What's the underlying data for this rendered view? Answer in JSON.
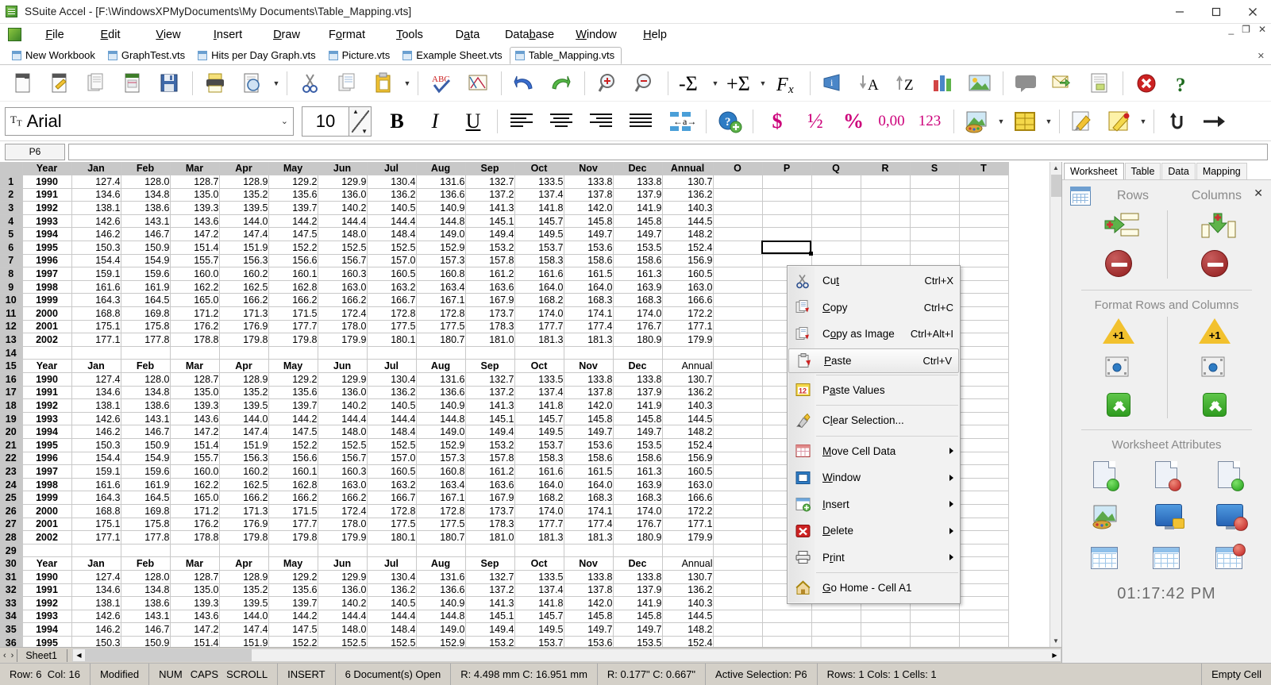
{
  "window": {
    "title": "SSuite Accel - [F:\\WindowsXPMyDocuments\\My Documents\\Table_Mapping.vts]",
    "minimize": "–",
    "maximize": "☐",
    "close": "✕",
    "inner_minimize": "_",
    "inner_restore": "❐",
    "inner_close": "✕"
  },
  "menubar": [
    {
      "label": "File",
      "accel": "F"
    },
    {
      "label": "Edit",
      "accel": "E"
    },
    {
      "label": "View",
      "accel": "V"
    },
    {
      "label": "Insert",
      "accel": "I"
    },
    {
      "label": "Draw",
      "accel": "D"
    },
    {
      "label": "Format",
      "accel": "o"
    },
    {
      "label": "Tools",
      "accel": "T"
    },
    {
      "label": "Data",
      "accel": "a"
    },
    {
      "label": "Database",
      "accel": "b"
    },
    {
      "label": "Window",
      "accel": "W"
    },
    {
      "label": "Help",
      "accel": "H"
    }
  ],
  "doctabs": [
    {
      "label": "New Workbook",
      "active": false
    },
    {
      "label": "GraphTest.vts",
      "active": false
    },
    {
      "label": "Hits per Day Graph.vts",
      "active": false
    },
    {
      "label": "Picture.vts",
      "active": false
    },
    {
      "label": "Example Sheet.vts",
      "active": false
    },
    {
      "label": "Table_Mapping.vts",
      "active": true
    }
  ],
  "toolbar_icons": [
    "new-document-icon",
    "open-document-icon",
    "copy-document-icon",
    "document-properties-icon",
    "save-icon",
    "print-icon",
    "print-preview-icon",
    "cut-icon",
    "copy-icon",
    "paste-icon",
    "spellcheck-icon",
    "drawing-icon",
    "chart-icon",
    "undo-icon",
    "redo-icon",
    "zoom-in-icon",
    "zoom-out-icon",
    "sum-minus-icon",
    "sum-plus-icon",
    "function-icon",
    "info-icon",
    "sort-ascending-icon",
    "sort-descending-icon",
    "bar-chart-icon",
    "image-icon",
    "comment-icon",
    "send-mail-icon",
    "report-icon",
    "close-document-icon",
    "help-icon"
  ],
  "format_toolbar": {
    "font_name": "Arial",
    "font_size": "10",
    "bold": "B",
    "italic": "I",
    "underline": "U",
    "align_left": "align-left-icon",
    "align_center": "align-center-icon",
    "align_right": "align-right-icon",
    "align_justify": "align-justify-icon",
    "merge": "←a→",
    "help_add": "help-add-icon",
    "currency": "$",
    "fraction": "½",
    "percent": "%",
    "decimal": "0,00",
    "number": "123",
    "fill_color": "fill-color-icon",
    "borders": "borders-icon",
    "brush": "format-painter-icon",
    "pencil": "edit-pencil-icon",
    "refresh": "refresh-icon",
    "arrow": "go-arrow-icon"
  },
  "formula_bar": {
    "name_box": "P6",
    "formula": ""
  },
  "grid": {
    "column_letters": [
      "",
      "Year",
      "Jan",
      "Feb",
      "Mar",
      "Apr",
      "May",
      "Jun",
      "Jul",
      "Aug",
      "Sep",
      "Oct",
      "Nov",
      "Dec",
      "Annual",
      "O",
      "P",
      "Q",
      "R",
      "S",
      "T"
    ],
    "extra_columns": [
      "O",
      "P",
      "Q",
      "R",
      "S",
      "T"
    ],
    "selected_cell": "P6",
    "headers": [
      "Year",
      "Jan",
      "Feb",
      "Mar",
      "Apr",
      "May",
      "Jun",
      "Jul",
      "Aug",
      "Sep",
      "Oct",
      "Nov",
      "Dec",
      "Annual"
    ],
    "rows_data": [
      {
        "year": "1990",
        "m": [
          "127.4",
          "128.0",
          "128.7",
          "128.9",
          "129.2",
          "129.9",
          "130.4",
          "131.6",
          "132.7",
          "133.5",
          "133.8",
          "133.8"
        ],
        "annual": "130.7"
      },
      {
        "year": "1991",
        "m": [
          "134.6",
          "134.8",
          "135.0",
          "135.2",
          "135.6",
          "136.0",
          "136.2",
          "136.6",
          "137.2",
          "137.4",
          "137.8",
          "137.9"
        ],
        "annual": "136.2"
      },
      {
        "year": "1992",
        "m": [
          "138.1",
          "138.6",
          "139.3",
          "139.5",
          "139.7",
          "140.2",
          "140.5",
          "140.9",
          "141.3",
          "141.8",
          "142.0",
          "141.9"
        ],
        "annual": "140.3"
      },
      {
        "year": "1993",
        "m": [
          "142.6",
          "143.1",
          "143.6",
          "144.0",
          "144.2",
          "144.4",
          "144.4",
          "144.8",
          "145.1",
          "145.7",
          "145.8",
          "145.8"
        ],
        "annual": "144.5"
      },
      {
        "year": "1994",
        "m": [
          "146.2",
          "146.7",
          "147.2",
          "147.4",
          "147.5",
          "148.0",
          "148.4",
          "149.0",
          "149.4",
          "149.5",
          "149.7",
          "149.7"
        ],
        "annual": "148.2"
      },
      {
        "year": "1995",
        "m": [
          "150.3",
          "150.9",
          "151.4",
          "151.9",
          "152.2",
          "152.5",
          "152.5",
          "152.9",
          "153.2",
          "153.7",
          "153.6",
          "153.5"
        ],
        "annual": "152.4"
      },
      {
        "year": "1996",
        "m": [
          "154.4",
          "154.9",
          "155.7",
          "156.3",
          "156.6",
          "156.7",
          "157.0",
          "157.3",
          "157.8",
          "158.3",
          "158.6",
          "158.6"
        ],
        "annual": "156.9"
      },
      {
        "year": "1997",
        "m": [
          "159.1",
          "159.6",
          "160.0",
          "160.2",
          "160.1",
          "160.3",
          "160.5",
          "160.8",
          "161.2",
          "161.6",
          "161.5",
          "161.3"
        ],
        "annual": "160.5"
      },
      {
        "year": "1998",
        "m": [
          "161.6",
          "161.9",
          "162.2",
          "162.5",
          "162.8",
          "163.0",
          "163.2",
          "163.4",
          "163.6",
          "164.0",
          "164.0",
          "163.9"
        ],
        "annual": "163.0"
      },
      {
        "year": "1999",
        "m": [
          "164.3",
          "164.5",
          "165.0",
          "166.2",
          "166.2",
          "166.2",
          "166.7",
          "167.1",
          "167.9",
          "168.2",
          "168.3",
          "168.3"
        ],
        "annual": "166.6"
      },
      {
        "year": "2000",
        "m": [
          "168.8",
          "169.8",
          "171.2",
          "171.3",
          "171.5",
          "172.4",
          "172.8",
          "172.8",
          "173.7",
          "174.0",
          "174.1",
          "174.0"
        ],
        "annual": "172.2"
      },
      {
        "year": "2001",
        "m": [
          "175.1",
          "175.8",
          "176.2",
          "176.9",
          "177.7",
          "178.0",
          "177.5",
          "177.5",
          "178.3",
          "177.7",
          "177.4",
          "176.7"
        ],
        "annual": "177.1"
      },
      {
        "year": "2002",
        "m": [
          "177.1",
          "177.8",
          "178.8",
          "179.8",
          "179.8",
          "179.9",
          "180.1",
          "180.7",
          "181.0",
          "181.3",
          "181.3",
          "180.9"
        ],
        "annual": "179.9"
      }
    ]
  },
  "context_menu": {
    "items": [
      {
        "label": "Cut",
        "accel": "t",
        "shortcut": "Ctrl+X",
        "icon": "cut-icon",
        "submenu": false,
        "selected": false
      },
      {
        "label": "Copy",
        "accel": "C",
        "shortcut": "Ctrl+C",
        "icon": "copy-icon",
        "submenu": false,
        "selected": false
      },
      {
        "label": "Copy as Image",
        "accel": "o",
        "shortcut": "Ctrl+Alt+I",
        "icon": "copy-image-icon",
        "submenu": false,
        "selected": false
      },
      {
        "label": "Paste",
        "accel": "P",
        "shortcut": "Ctrl+V",
        "icon": "paste-icon",
        "submenu": false,
        "selected": true
      },
      {
        "label": "Paste Values",
        "accel": "a",
        "shortcut": "",
        "icon": "paste-values-icon",
        "submenu": false,
        "selected": false
      },
      {
        "label": "Clear Selection...",
        "accel": "l",
        "shortcut": "",
        "icon": "clear-selection-icon",
        "submenu": false,
        "selected": false
      },
      {
        "label": "Move Cell Data",
        "accel": "M",
        "shortcut": "",
        "icon": "move-cell-icon",
        "submenu": true,
        "selected": false
      },
      {
        "label": "Window",
        "accel": "W",
        "shortcut": "",
        "icon": "window-icon",
        "submenu": true,
        "selected": false
      },
      {
        "label": "Insert",
        "accel": "I",
        "shortcut": "",
        "icon": "insert-icon",
        "submenu": true,
        "selected": false
      },
      {
        "label": "Delete",
        "accel": "D",
        "shortcut": "",
        "icon": "delete-icon",
        "submenu": true,
        "selected": false
      },
      {
        "label": "Print",
        "accel": "r",
        "shortcut": "",
        "icon": "print-icon",
        "submenu": true,
        "selected": false
      },
      {
        "label": "Go Home - Cell A1",
        "accel": "G",
        "shortcut": "",
        "icon": "home-icon",
        "submenu": false,
        "selected": false
      }
    ]
  },
  "right_panel": {
    "tabs": [
      {
        "label": "Worksheet",
        "active": true
      },
      {
        "label": "Table",
        "active": false
      },
      {
        "label": "Data",
        "active": false
      },
      {
        "label": "Mapping",
        "active": false
      }
    ],
    "close": "✕",
    "rows_label": "Rows",
    "columns_label": "Columns",
    "format_section": "Format Rows and Columns",
    "attributes_section": "Worksheet Attributes",
    "clock": "01:17:42 PM",
    "icons": {
      "insert_row": "insert-row-icon",
      "insert_column": "insert-column-icon",
      "delete_row": "delete-row-icon",
      "delete_column": "delete-column-icon",
      "row_height_plus": "row-height-increase-icon",
      "column_width_plus": "column-width-increase-icon",
      "row_settings": "row-settings-icon",
      "column_settings": "column-settings-icon",
      "row_apply": "row-apply-icon",
      "column_apply": "column-apply-icon",
      "new_sheet": "new-sheet-icon",
      "remove_sheet": "remove-sheet-icon",
      "add_sheet": "add-sheet-icon",
      "sheet_color": "sheet-color-icon",
      "lock_sheet": "lock-sheet-icon",
      "close_sheet": "close-sheet-icon",
      "export_table": "export-table-icon",
      "import_table": "import-table-icon",
      "delete_table": "delete-table-icon"
    }
  },
  "sheet_tabs": {
    "prev": "‹",
    "next": "›",
    "tabs": [
      "Sheet1"
    ]
  },
  "statusbar": {
    "row_label": "Row:",
    "row_value": "6",
    "col_label": "Col:",
    "col_value": "16",
    "modified": "Modified",
    "num": "NUM",
    "caps": "CAPS",
    "scroll": "SCROLL",
    "insert": "INSERT",
    "documents_open": "6 Document(s) Open",
    "metric": "R: 4.498 mm   C: 16.951 mm",
    "imperial": "R: 0.177\"   C: 0.667\"",
    "active_selection": "Active Selection: P6",
    "counts": "Rows: 1  Cols: 1  Cells: 1",
    "cell_state": "Empty Cell"
  },
  "colors": {
    "header_gray": "#c8c8c8",
    "year_blue": "#9dc3e6",
    "annual_dark": "#1f8fce",
    "annual_light": "#9bd0ee",
    "pink_header": "#edaec1",
    "green_row": "#d9f5d3",
    "cyan_row": "#9fdcdc",
    "statusbar": "#d4d0c8"
  }
}
